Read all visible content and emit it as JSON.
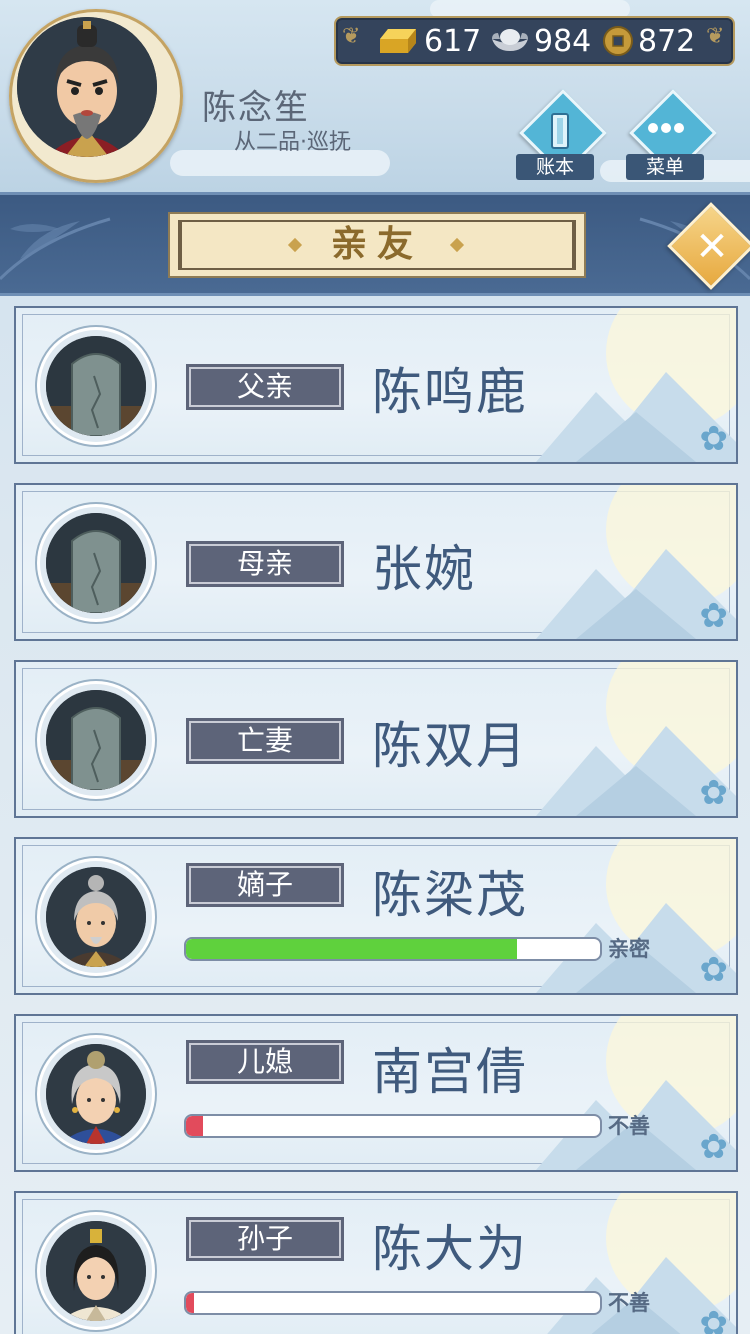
{
  "player": {
    "name": "陈念笙",
    "rank": "从二品·巡抚",
    "avatar_icon": "official-portrait"
  },
  "currency": {
    "gold": "617",
    "silver": "984",
    "copper": "872"
  },
  "menu_buttons": {
    "ledger_label": "账本",
    "menu_label": "菜单"
  },
  "title": "亲友",
  "colors": {
    "accent_blue": "#3c5a82",
    "bar_green": "#5fd13d",
    "bar_red": "#e24b5c",
    "tag_bg": "#5d6479",
    "name_text": "#3f5a7d"
  },
  "relatives": [
    {
      "relation": "父亲",
      "name": "陈鸣鹿",
      "portrait": "tombstone-icon"
    },
    {
      "relation": "母亲",
      "name": "张婉",
      "portrait": "tombstone-icon"
    },
    {
      "relation": "亡妻",
      "name": "陈双月",
      "portrait": "tombstone-icon"
    },
    {
      "relation": "嫡子",
      "name": "陈梁茂",
      "portrait": "elder-man-portrait",
      "affinity": 0.8,
      "affinity_label": "亲密",
      "bar_color": "green"
    },
    {
      "relation": "儿媳",
      "name": "南宫倩",
      "portrait": "elder-woman-portrait",
      "affinity": 0.04,
      "affinity_label": "不善",
      "bar_color": "red"
    },
    {
      "relation": "孙子",
      "name": "陈大为",
      "portrait": "young-man-portrait",
      "affinity": 0.02,
      "affinity_label": "不善",
      "bar_color": "red"
    }
  ]
}
